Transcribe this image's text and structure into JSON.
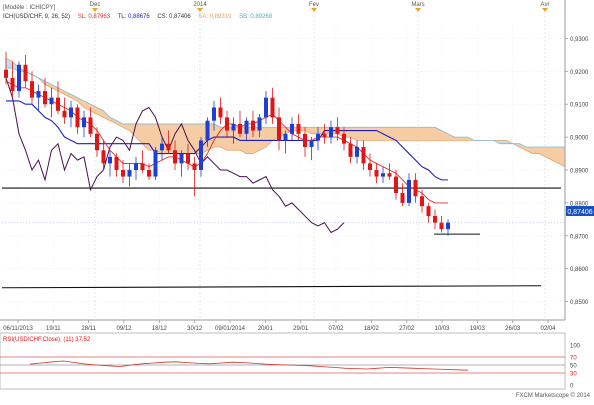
{
  "header": {
    "model_label": "[Modèle : ICHICPY]",
    "indicator": "ICH(USD/CHF, 9, 26, 52)",
    "sl_label": "SL: 0,87963",
    "tl_label": "TL: 0,88676",
    "cs_label": "CS: 0,87406",
    "sa_label": "SA: 0,89319",
    "sb_label": "SB: 0,89268"
  },
  "top_markers": [
    "Dec",
    "2014",
    "Fev",
    "Mars",
    "Avr"
  ],
  "price_axis": [
    "0,9300",
    "0,9200",
    "0,9100",
    "0,9000",
    "0,8900",
    "0,8800",
    "0,8700",
    "0,8600",
    "0,8500"
  ],
  "last_price_tag": "0,87406",
  "date_axis": [
    "06/11/2013",
    "19/11",
    "28/11",
    "09/12",
    "18/12",
    "30/12",
    "09/01/2014",
    "20/01",
    "29/01",
    "07/02",
    "18/02",
    "27/02",
    "10/03",
    "19/03",
    "26/03",
    "02/04"
  ],
  "rsi": {
    "label": "RSI(USD/CHF,Close), (11) 37,52",
    "axis": [
      "100",
      "70",
      "50",
      "30",
      "0"
    ]
  },
  "footer": "FXCM Marketscope © 2014",
  "colors": {
    "bull": "#1e3fd0",
    "bear": "#e01515",
    "tenkan": "#e82a2a",
    "kijun": "#1c1cc8",
    "chikou": "#4a0e4e",
    "cloud_bear": "#f6c9a0",
    "cloud_bull": "#b7ddf0",
    "span_a": "#f0a060",
    "span_b": "#7bbcd8"
  },
  "chart_data": {
    "type": "candlestick",
    "symbol": "USD/CHF",
    "ylim": [
      0.845,
      0.935
    ],
    "candles": [
      [
        0.9205,
        0.926,
        0.916,
        0.918
      ],
      [
        0.918,
        0.923,
        0.912,
        0.914
      ],
      [
        0.914,
        0.923,
        0.912,
        0.922
      ],
      [
        0.922,
        0.925,
        0.915,
        0.917
      ],
      [
        0.917,
        0.92,
        0.91,
        0.912
      ],
      [
        0.912,
        0.916,
        0.908,
        0.914
      ],
      [
        0.914,
        0.918,
        0.909,
        0.91
      ],
      [
        0.91,
        0.915,
        0.906,
        0.912
      ],
      [
        0.912,
        0.917,
        0.907,
        0.908
      ],
      [
        0.908,
        0.912,
        0.904,
        0.906
      ],
      [
        0.906,
        0.911,
        0.903,
        0.909
      ],
      [
        0.909,
        0.91,
        0.901,
        0.903
      ],
      [
        0.903,
        0.908,
        0.9,
        0.906
      ],
      [
        0.906,
        0.909,
        0.9,
        0.901
      ],
      [
        0.901,
        0.903,
        0.894,
        0.896
      ],
      [
        0.896,
        0.899,
        0.89,
        0.892
      ],
      [
        0.892,
        0.896,
        0.888,
        0.894
      ],
      [
        0.894,
        0.895,
        0.888,
        0.89
      ],
      [
        0.89,
        0.893,
        0.886,
        0.888
      ],
      [
        0.888,
        0.892,
        0.885,
        0.89
      ],
      [
        0.89,
        0.894,
        0.887,
        0.892
      ],
      [
        0.892,
        0.896,
        0.889,
        0.89
      ],
      [
        0.89,
        0.892,
        0.887,
        0.888
      ],
      [
        0.888,
        0.897,
        0.887,
        0.896
      ],
      [
        0.896,
        0.9,
        0.893,
        0.898
      ],
      [
        0.898,
        0.902,
        0.895,
        0.896
      ],
      [
        0.896,
        0.899,
        0.89,
        0.892
      ],
      [
        0.892,
        0.896,
        0.888,
        0.895
      ],
      [
        0.895,
        0.898,
        0.89,
        0.892
      ],
      [
        0.892,
        0.894,
        0.882,
        0.89
      ],
      [
        0.89,
        0.9,
        0.888,
        0.899
      ],
      [
        0.899,
        0.906,
        0.897,
        0.905
      ],
      [
        0.905,
        0.911,
        0.902,
        0.909
      ],
      [
        0.909,
        0.912,
        0.904,
        0.906
      ],
      [
        0.906,
        0.908,
        0.9,
        0.902
      ],
      [
        0.902,
        0.906,
        0.898,
        0.904
      ],
      [
        0.904,
        0.908,
        0.9,
        0.901
      ],
      [
        0.901,
        0.906,
        0.899,
        0.905
      ],
      [
        0.905,
        0.908,
        0.9,
        0.902
      ],
      [
        0.902,
        0.907,
        0.9,
        0.906
      ],
      [
        0.906,
        0.914,
        0.904,
        0.912
      ],
      [
        0.912,
        0.915,
        0.904,
        0.906
      ],
      [
        0.906,
        0.909,
        0.896,
        0.899
      ],
      [
        0.899,
        0.902,
        0.895,
        0.901
      ],
      [
        0.901,
        0.906,
        0.899,
        0.904
      ],
      [
        0.904,
        0.907,
        0.899,
        0.901
      ],
      [
        0.901,
        0.903,
        0.894,
        0.897
      ],
      [
        0.897,
        0.9,
        0.893,
        0.899
      ],
      [
        0.899,
        0.903,
        0.896,
        0.901
      ],
      [
        0.901,
        0.904,
        0.898,
        0.9
      ],
      [
        0.9,
        0.905,
        0.898,
        0.903
      ],
      [
        0.903,
        0.906,
        0.899,
        0.901
      ],
      [
        0.901,
        0.903,
        0.896,
        0.898
      ],
      [
        0.898,
        0.9,
        0.892,
        0.894
      ],
      [
        0.894,
        0.899,
        0.892,
        0.897
      ],
      [
        0.897,
        0.899,
        0.89,
        0.892
      ],
      [
        0.892,
        0.895,
        0.888,
        0.89
      ],
      [
        0.89,
        0.892,
        0.886,
        0.888
      ],
      [
        0.888,
        0.891,
        0.886,
        0.889
      ],
      [
        0.889,
        0.892,
        0.887,
        0.888
      ],
      [
        0.888,
        0.89,
        0.881,
        0.883
      ],
      [
        0.883,
        0.886,
        0.879,
        0.88
      ],
      [
        0.88,
        0.889,
        0.879,
        0.887
      ],
      [
        0.887,
        0.889,
        0.88,
        0.882
      ],
      [
        0.882,
        0.884,
        0.877,
        0.879
      ],
      [
        0.879,
        0.88,
        0.874,
        0.876
      ],
      [
        0.876,
        0.878,
        0.872,
        0.874
      ],
      [
        0.874,
        0.876,
        0.871,
        0.872
      ],
      [
        0.872,
        0.875,
        0.87,
        0.874
      ]
    ],
    "tenkan_sen": [
      0.917,
      0.916,
      0.915,
      0.915,
      0.914,
      0.913,
      0.912,
      0.911,
      0.91,
      0.909,
      0.908,
      0.906,
      0.905,
      0.904,
      0.902,
      0.899,
      0.896,
      0.894,
      0.892,
      0.892,
      0.892,
      0.892,
      0.891,
      0.892,
      0.893,
      0.894,
      0.894,
      0.893,
      0.892,
      0.891,
      0.892,
      0.895,
      0.899,
      0.902,
      0.904,
      0.904,
      0.903,
      0.904,
      0.904,
      0.905,
      0.906,
      0.907,
      0.905,
      0.903,
      0.901,
      0.9,
      0.899,
      0.899,
      0.9,
      0.9,
      0.9,
      0.9,
      0.899,
      0.898,
      0.897,
      0.895,
      0.893,
      0.892,
      0.891,
      0.89,
      0.889,
      0.887,
      0.885,
      0.884,
      0.883,
      0.881,
      0.88,
      0.88,
      0.88
    ],
    "kijun_sen": [
      0.911,
      0.911,
      0.911,
      0.91,
      0.91,
      0.908,
      0.906,
      0.905,
      0.903,
      0.9,
      0.899,
      0.898,
      0.898,
      0.898,
      0.898,
      0.898,
      0.898,
      0.898,
      0.898,
      0.898,
      0.898,
      0.898,
      0.898,
      0.895,
      0.895,
      0.895,
      0.895,
      0.895,
      0.895,
      0.895,
      0.897,
      0.899,
      0.9,
      0.9,
      0.9,
      0.9,
      0.899,
      0.899,
      0.899,
      0.899,
      0.899,
      0.899,
      0.899,
      0.899,
      0.899,
      0.899,
      0.899,
      0.899,
      0.899,
      0.902,
      0.902,
      0.902,
      0.902,
      0.902,
      0.902,
      0.902,
      0.902,
      0.902,
      0.901,
      0.9,
      0.899,
      0.897,
      0.895,
      0.893,
      0.891,
      0.89,
      0.888,
      0.887,
      0.887
    ],
    "span_a": [
      0.924,
      0.923,
      0.921,
      0.92,
      0.919,
      0.918,
      0.916,
      0.915,
      0.914,
      0.913,
      0.912,
      0.911,
      0.909,
      0.908,
      0.907,
      0.906,
      0.905,
      0.904,
      0.903,
      0.902,
      0.9,
      0.898,
      0.896,
      0.896,
      0.895,
      0.895,
      0.895,
      0.895,
      0.895,
      0.895,
      0.895,
      0.896,
      0.897,
      0.897,
      0.896,
      0.896,
      0.896,
      0.895,
      0.895,
      0.896,
      0.897,
      0.899,
      0.9,
      0.901,
      0.902,
      0.902,
      0.902,
      0.901,
      0.901,
      0.901,
      0.901,
      0.901,
      0.9,
      0.9,
      0.899,
      0.899,
      0.899,
      0.899,
      0.899,
      0.899,
      0.899,
      0.899,
      0.899,
      0.899,
      0.899,
      0.899,
      0.899,
      0.899,
      0.899,
      0.899,
      0.899,
      0.899,
      0.899,
      0.899,
      0.899,
      0.899,
      0.899,
      0.899,
      0.898,
      0.897,
      0.896,
      0.895,
      0.895,
      0.894,
      0.893,
      0.892,
      0.891,
      0.89,
      0.889,
      0.889,
      0.889,
      0.889,
      0.889,
      0.889,
      0.889
    ],
    "span_b": [
      0.921,
      0.921,
      0.92,
      0.92,
      0.919,
      0.918,
      0.917,
      0.916,
      0.915,
      0.914,
      0.913,
      0.912,
      0.911,
      0.91,
      0.909,
      0.908,
      0.906,
      0.905,
      0.904,
      0.904,
      0.904,
      0.904,
      0.904,
      0.904,
      0.904,
      0.904,
      0.904,
      0.904,
      0.904,
      0.904,
      0.904,
      0.904,
      0.904,
      0.903,
      0.903,
      0.903,
      0.903,
      0.903,
      0.903,
      0.903,
      0.903,
      0.903,
      0.903,
      0.903,
      0.903,
      0.903,
      0.903,
      0.903,
      0.903,
      0.903,
      0.903,
      0.903,
      0.903,
      0.903,
      0.903,
      0.903,
      0.903,
      0.903,
      0.903,
      0.903,
      0.903,
      0.903,
      0.903,
      0.903,
      0.903,
      0.903,
      0.903,
      0.902,
      0.901,
      0.9,
      0.9,
      0.9,
      0.899,
      0.899,
      0.899,
      0.899,
      0.898,
      0.898,
      0.898,
      0.898,
      0.897,
      0.897,
      0.897,
      0.897,
      0.897,
      0.897,
      0.897,
      0.897,
      0.897,
      0.897,
      0.897,
      0.897,
      0.897,
      0.897,
      0.897
    ],
    "chikou": [
      0.918,
      0.912,
      0.901,
      0.896,
      0.89,
      0.893,
      0.887,
      0.896,
      0.898,
      0.89,
      0.895,
      0.893,
      0.894,
      0.884,
      0.888,
      0.89,
      0.897,
      0.9,
      0.899,
      0.896,
      0.904,
      0.908,
      0.909,
      0.906,
      0.9,
      0.896,
      0.901,
      0.904,
      0.899,
      0.896,
      0.892,
      0.894,
      0.892,
      0.89,
      0.89,
      0.889,
      0.888,
      0.888,
      0.886,
      0.887,
      0.888,
      0.884,
      0.882,
      0.879,
      0.88,
      0.878,
      0.876,
      0.874,
      0.873,
      0.874,
      0.871,
      0.872,
      0.874
    ],
    "horizontal_lines": [
      0.8845,
      0.8545
    ],
    "support_segment": 0.8705,
    "rsi": {
      "value": 37.52,
      "levels": [
        70,
        50,
        30
      ],
      "values": [
        52,
        55,
        58,
        60,
        56,
        52,
        50,
        48,
        46,
        50,
        53,
        55,
        57,
        58,
        56,
        54,
        53,
        55,
        57,
        56,
        54,
        52,
        51,
        50,
        49,
        48,
        46,
        44,
        42,
        41,
        40,
        42,
        44,
        43,
        42,
        41,
        40,
        39,
        38,
        37
      ]
    }
  }
}
